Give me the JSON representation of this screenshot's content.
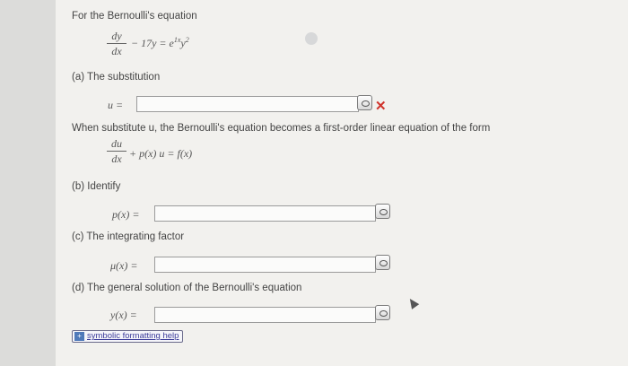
{
  "problem": {
    "intro": "For the Bernoulli's equation",
    "equation": {
      "numerator": "dy",
      "denominator": "dx",
      "middle": "− 17y = e",
      "exponent": "1x",
      "tail": "y",
      "tail_exponent": "2"
    }
  },
  "part_a": {
    "label": "(a) The substitution",
    "var_label": "u =",
    "value": "",
    "result_mark": "✕"
  },
  "transform": {
    "text": "When substitute u, the Bernoulli's equation becomes a first-order linear equation of the form",
    "numerator": "du",
    "denominator": "dx",
    "rest": "+ p(x) u = f(x)"
  },
  "part_b": {
    "label": "(b) Identify",
    "var_label": "p(x) =",
    "value": ""
  },
  "part_c": {
    "label": "(c) The integrating factor",
    "var_label": "μ(x) =",
    "value": ""
  },
  "part_d": {
    "label": "(d) The general solution of the Bernoulli's equation",
    "var_label": "y(x) =",
    "value": ""
  },
  "help": {
    "icon": "+",
    "label": "symbolic formatting help"
  }
}
